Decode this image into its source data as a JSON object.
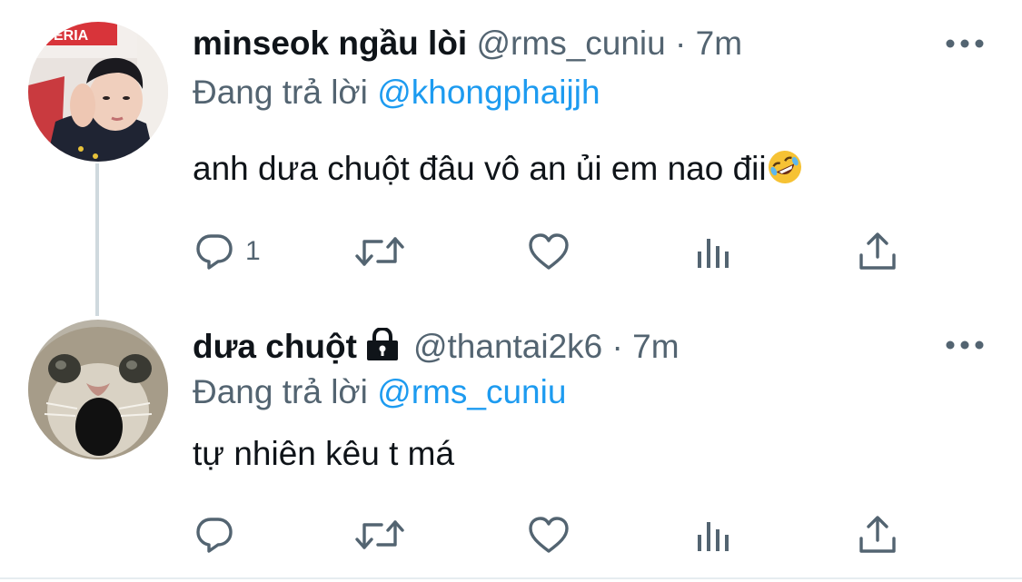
{
  "tweets": [
    {
      "display_name": "minseok ngầu lòi",
      "handle": "@rms_cuniu",
      "separator": "·",
      "time": "7m",
      "reply_prefix": "Đang trả lời",
      "reply_to": "@khongphaijjh",
      "text": "anh dưa chuột đâu vô an ủi em nao đii",
      "emoji": "rolling-on-floor-laughing",
      "reply_count": "1",
      "avatar": "person-photo"
    },
    {
      "display_name": "dưa chuột",
      "handle": "@thantai2k6",
      "separator": "·",
      "time": "7m",
      "reply_prefix": "Đang trả lời",
      "reply_to": "@rms_cuniu",
      "text": "tự nhiên kêu t má",
      "protected": true,
      "avatar": "cat-photo"
    }
  ],
  "icons": [
    "reply-icon",
    "retweet-icon",
    "like-icon",
    "analytics-icon",
    "share-icon",
    "more-icon",
    "lock-icon"
  ],
  "colors": {
    "text": "#0f1419",
    "secondary": "#536471",
    "accent": "#1d9bf0",
    "thread_line": "#cfd9de"
  }
}
